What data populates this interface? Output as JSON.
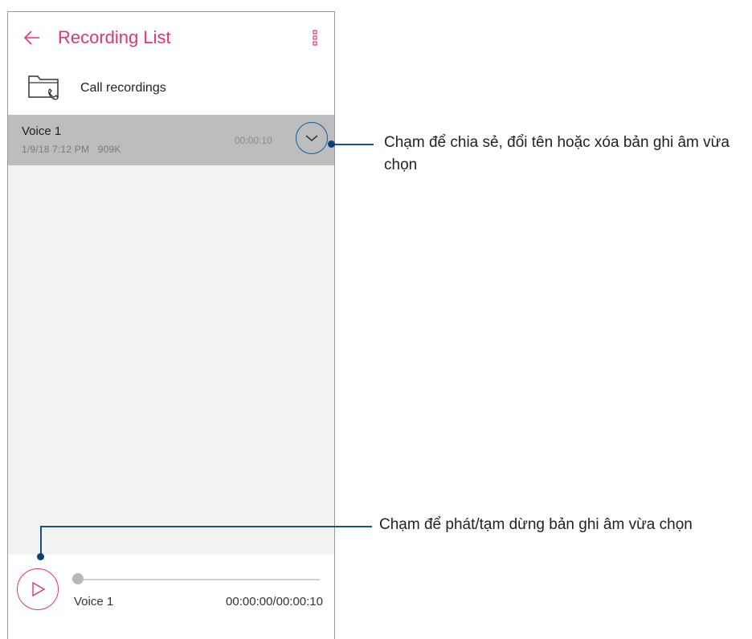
{
  "app_bar": {
    "title": "Recording List",
    "back_icon": "arrow-left-icon",
    "menu_icon": "more-vertical-icon",
    "accent_color": "#e3356b"
  },
  "folder": {
    "label": "Call recordings",
    "icon": "folder-phone-icon"
  },
  "recordings": [
    {
      "name": "Voice 1",
      "date": "1/9/18 7:12 PM",
      "size": "909K",
      "meta": "1/9/18 7:12 PM   909K",
      "duration": "00:00:10",
      "selected": true
    }
  ],
  "player": {
    "name": "Voice 1",
    "time": "00:00:00/00:00:10",
    "progress": 0,
    "play_icon": "play-icon"
  },
  "callouts": [
    {
      "text": "Chạm để chia sẻ, đổi tên hoặc xóa bản ghi âm vừa chọn"
    },
    {
      "text": "Chạm để phát/tạm dừng bản ghi âm vừa chọn"
    }
  ],
  "colors": {
    "accent": "#e3356b",
    "callout": "#1b4f8c",
    "selected_row": "#bdbdbd",
    "list_background": "#f3f3f3"
  }
}
